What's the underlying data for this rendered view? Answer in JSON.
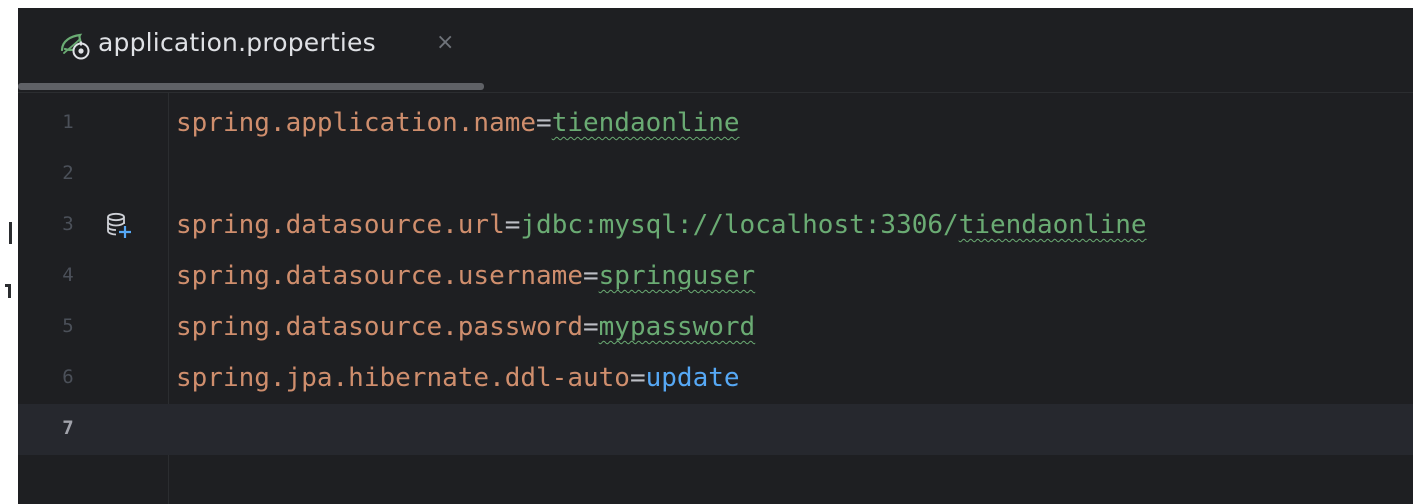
{
  "tab": {
    "filename": "application.properties",
    "close_glyph": "×",
    "icon": "spring-properties-icon"
  },
  "editor": {
    "current_line": 7,
    "lines": [
      {
        "number": "1",
        "key": "spring.application.name",
        "eq": "=",
        "value_pre": "",
        "value_typo": "tiendaonline"
      },
      {
        "number": "2"
      },
      {
        "number": "3",
        "key": "spring.datasource.url",
        "eq": "=",
        "value_pre": "jdbc:mysql://localhost:3306/",
        "value_typo": "tiendaonline",
        "gutter_icon": "database-add-icon"
      },
      {
        "number": "4",
        "key": "spring.datasource.username",
        "eq": "=",
        "value_pre": "",
        "value_typo": "springuser"
      },
      {
        "number": "5",
        "key": "spring.datasource.password",
        "eq": "=",
        "value_pre": "",
        "value_typo": "mypassword"
      },
      {
        "number": "6",
        "key": "spring.jpa.hibernate.ddl-auto",
        "eq": "=",
        "value_keyword": "update"
      },
      {
        "number": "7"
      }
    ]
  },
  "colors": {
    "background": "#1e1f22",
    "key": "#cf8e6d",
    "value": "#6aab73",
    "keyword": "#56a8f5",
    "line_number": "#4b5059",
    "current_line": "#26282e"
  }
}
